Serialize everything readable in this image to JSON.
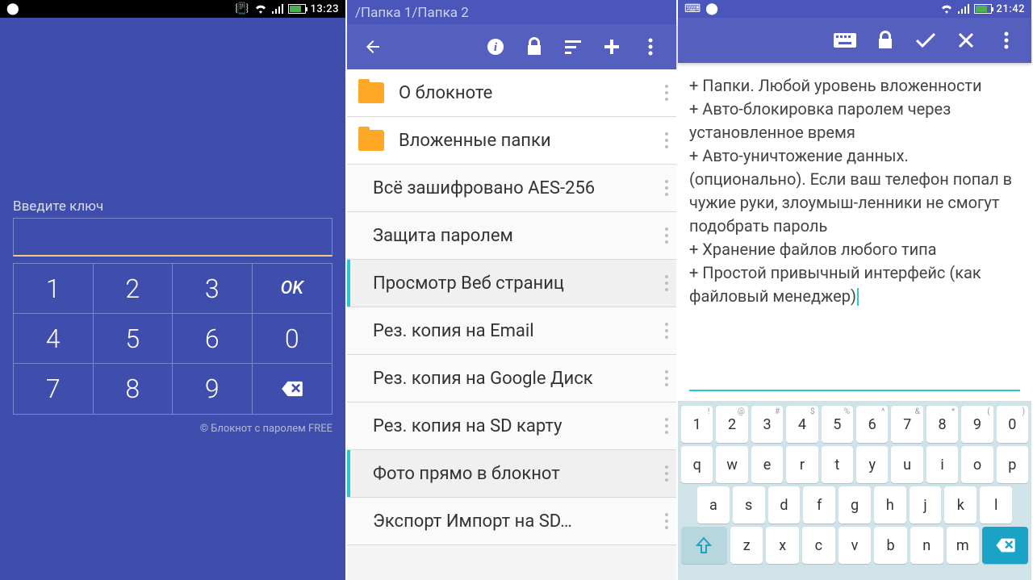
{
  "phone1": {
    "status": {
      "time": "13:23"
    },
    "input_label": "Введите ключ",
    "keys": [
      "1",
      "2",
      "3",
      "OK",
      "4",
      "5",
      "6",
      "0",
      "7",
      "8",
      "9"
    ],
    "footer": "© Блокнот с паролем FREE"
  },
  "phone2": {
    "path": "/Папка 1/Папка 2",
    "items": [
      {
        "type": "folder",
        "label": "О блокноте"
      },
      {
        "type": "folder",
        "label": "Вложенные папки"
      },
      {
        "type": "note",
        "label": "Всё зашифровано AES-256"
      },
      {
        "type": "note",
        "label": "Защита паролем"
      },
      {
        "type": "note",
        "label": "Просмотр Веб страниц",
        "selected": true
      },
      {
        "type": "note",
        "label": "Рез. копия на Email"
      },
      {
        "type": "note",
        "label": "Рез. копия на Google Диск"
      },
      {
        "type": "note",
        "label": "Рез. копия на SD карту"
      },
      {
        "type": "note",
        "label": "Фото прямо в блокнот",
        "selected": true
      },
      {
        "type": "note",
        "label": "Экспорт Импорт на SD…"
      }
    ]
  },
  "phone3": {
    "status": {
      "time": "21:42"
    },
    "note_text": "+ Папки. Любой уровень вложенности\n+ Авто-блокировка паролем через установленное время\n+ Авто-уничтожение данных. (опционально). Если ваш телефон попал в чужие руки, злоумыш-ленники не смогут подобрать пароль\n+ Хранение файлов любого типа\n+ Простой привычный интерфейс (как файловый менеджер)",
    "keyboard": {
      "row1": [
        {
          "k": "1",
          "s": "!"
        },
        {
          "k": "2",
          "s": "@"
        },
        {
          "k": "3",
          "s": "#"
        },
        {
          "k": "4",
          "s": "$"
        },
        {
          "k": "5",
          "s": "%"
        },
        {
          "k": "6",
          "s": "^"
        },
        {
          "k": "7",
          "s": "&"
        },
        {
          "k": "8",
          "s": "*"
        },
        {
          "k": "9",
          "s": "("
        },
        {
          "k": "0",
          "s": ")"
        }
      ],
      "row2": [
        {
          "k": "q"
        },
        {
          "k": "w"
        },
        {
          "k": "e"
        },
        {
          "k": "r"
        },
        {
          "k": "t"
        },
        {
          "k": "y"
        },
        {
          "k": "u"
        },
        {
          "k": "i"
        },
        {
          "k": "o"
        },
        {
          "k": "p"
        }
      ],
      "row3": [
        {
          "k": "a"
        },
        {
          "k": "s"
        },
        {
          "k": "d"
        },
        {
          "k": "f"
        },
        {
          "k": "g"
        },
        {
          "k": "h"
        },
        {
          "k": "j"
        },
        {
          "k": "k"
        },
        {
          "k": "l"
        }
      ],
      "row4": [
        {
          "k": "z"
        },
        {
          "k": "x"
        },
        {
          "k": "c"
        },
        {
          "k": "v"
        },
        {
          "k": "b"
        },
        {
          "k": "n"
        },
        {
          "k": "m"
        }
      ]
    }
  }
}
